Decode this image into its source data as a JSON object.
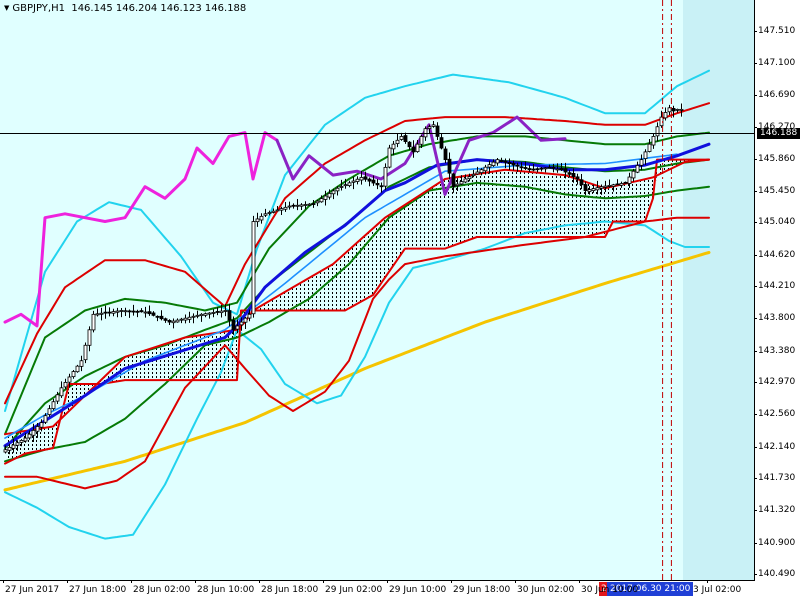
{
  "header": {
    "symbol": "GBPJPY,H1",
    "ohlc": "146.145 146.204 146.123 146.188"
  },
  "colors": {
    "background": "#e0ffff",
    "future_area": "#c9f1f6",
    "bullish_body": "#ffffff",
    "bearish_body": "#000000",
    "bid_line": "#000000",
    "ichimoku_cloud_hatch": "#000000",
    "ma_slow": "#f5c400",
    "vline_current": "#c00000",
    "time_tag_bg": "#1f3fd6",
    "time_tag_num_bg": "#e4161b"
  },
  "chart_data": {
    "type": "candlestick",
    "symbol": "GBPJPY",
    "timeframe": "H1",
    "ylim": [
      140.48,
      147.72
    ],
    "current_price": 146.188,
    "price_axis_ticks": [
      "147.510",
      "147.100",
      "146.690",
      "146.270",
      "145.860",
      "145.450",
      "145.040",
      "144.620",
      "144.210",
      "143.800",
      "143.380",
      "142.970",
      "142.560",
      "142.140",
      "141.730",
      "141.320",
      "140.900",
      "140.490"
    ],
    "time_axis_labels": [
      "27 Jun 2017",
      "27 Jun 18:00",
      "28 Jun 02:00",
      "28 Jun 10:00",
      "28 Jun 18:00",
      "29 Jun 02:00",
      "29 Jun 10:00",
      "29 Jun 18:00",
      "30 Jun 02:00",
      "30 Jun 10:00",
      "2017.06.30 21:00",
      "3 Jul 02:00"
    ],
    "time_tag_number": "2",
    "time_tag_selected": "2017.06.30 21:00",
    "price_anchors": [
      [
        0,
        142.07
      ],
      [
        6,
        142.25
      ],
      [
        10,
        142.45
      ],
      [
        15,
        142.9
      ],
      [
        20,
        143.25
      ],
      [
        23,
        143.85
      ],
      [
        30,
        143.9
      ],
      [
        36,
        143.88
      ],
      [
        42,
        143.75
      ],
      [
        50,
        143.85
      ],
      [
        56,
        143.9
      ],
      [
        58,
        143.65
      ],
      [
        62,
        143.85
      ],
      [
        63,
        145.05
      ],
      [
        66,
        145.15
      ],
      [
        72,
        145.25
      ],
      [
        78,
        145.28
      ],
      [
        84,
        145.48
      ],
      [
        90,
        145.62
      ],
      [
        95,
        145.5
      ],
      [
        97,
        146.0
      ],
      [
        100,
        146.15
      ],
      [
        103,
        145.95
      ],
      [
        106,
        146.25
      ],
      [
        108,
        146.3
      ],
      [
        111,
        145.85
      ],
      [
        113,
        145.5
      ],
      [
        116,
        145.6
      ],
      [
        120,
        145.72
      ],
      [
        124,
        145.85
      ],
      [
        128,
        145.78
      ],
      [
        132,
        145.72
      ],
      [
        137,
        145.75
      ],
      [
        140,
        145.72
      ],
      [
        144,
        145.6
      ],
      [
        146,
        145.45
      ],
      [
        150,
        145.5
      ],
      [
        156,
        145.55
      ],
      [
        160,
        145.85
      ],
      [
        163,
        146.15
      ],
      [
        165,
        146.4
      ],
      [
        167,
        146.52
      ],
      [
        168,
        146.48
      ],
      [
        169,
        146.5
      ]
    ],
    "future_from_bar": 169.5,
    "vlines_at_bars": [
      164.4,
      166.6
    ],
    "indicators": {
      "ma_slow_yellow": [
        [
          0,
          141.58
        ],
        [
          30,
          141.95
        ],
        [
          60,
          142.45
        ],
        [
          90,
          143.15
        ],
        [
          120,
          143.75
        ],
        [
          150,
          144.25
        ],
        [
          176,
          144.65
        ]
      ],
      "ma_blue_thick": [
        [
          0,
          142.15
        ],
        [
          20,
          142.8
        ],
        [
          30,
          143.15
        ],
        [
          55,
          143.55
        ],
        [
          58,
          143.7
        ],
        [
          65,
          144.2
        ],
        [
          75,
          144.65
        ],
        [
          85,
          145.0
        ],
        [
          95,
          145.45
        ],
        [
          100,
          145.55
        ],
        [
          108,
          145.78
        ],
        [
          118,
          145.85
        ],
        [
          130,
          145.8
        ],
        [
          140,
          145.72
        ],
        [
          150,
          145.72
        ],
        [
          160,
          145.78
        ],
        [
          168,
          145.9
        ],
        [
          176,
          146.05
        ]
      ],
      "ma_dodger": [
        [
          0,
          142.25
        ],
        [
          10,
          142.55
        ],
        [
          20,
          142.8
        ],
        [
          35,
          143.25
        ],
        [
          55,
          143.65
        ],
        [
          70,
          144.25
        ],
        [
          90,
          145.1
        ],
        [
          110,
          145.7
        ],
        [
          130,
          145.78
        ],
        [
          150,
          145.8
        ],
        [
          168,
          145.92
        ]
      ],
      "ichimoku_span_a_red": [
        [
          0,
          142.3
        ],
        [
          12,
          142.4
        ],
        [
          22,
          142.9
        ],
        [
          30,
          143.3
        ],
        [
          45,
          143.55
        ],
        [
          58,
          143.65
        ],
        [
          60,
          143.75
        ],
        [
          62,
          143.9
        ],
        [
          72,
          144.2
        ],
        [
          82,
          144.5
        ],
        [
          95,
          145.1
        ],
        [
          110,
          145.6
        ],
        [
          125,
          145.72
        ],
        [
          140,
          145.65
        ],
        [
          150,
          145.48
        ],
        [
          162,
          145.62
        ],
        [
          170,
          145.82
        ],
        [
          176,
          145.85
        ]
      ],
      "ichimoku_span_b_red": [
        [
          0,
          141.92
        ],
        [
          5,
          142.05
        ],
        [
          12,
          142.12
        ],
        [
          16,
          142.95
        ],
        [
          24,
          142.95
        ],
        [
          30,
          143.0
        ],
        [
          45,
          143.0
        ],
        [
          58,
          143.0
        ],
        [
          59,
          143.9
        ],
        [
          85,
          143.9
        ],
        [
          92,
          144.1
        ],
        [
          100,
          144.7
        ],
        [
          110,
          144.7
        ],
        [
          118,
          144.85
        ],
        [
          130,
          144.85
        ],
        [
          150,
          144.85
        ],
        [
          152,
          145.05
        ],
        [
          160,
          145.05
        ],
        [
          162,
          145.35
        ],
        [
          163,
          145.85
        ],
        [
          176,
          145.85
        ]
      ],
      "bollinger_red": {
        "upper": [
          [
            0,
            142.7
          ],
          [
            8,
            143.6
          ],
          [
            15,
            144.2
          ],
          [
            25,
            144.55
          ],
          [
            35,
            144.55
          ],
          [
            45,
            144.4
          ],
          [
            55,
            143.95
          ],
          [
            60,
            144.5
          ],
          [
            70,
            145.35
          ],
          [
            80,
            145.8
          ],
          [
            90,
            146.1
          ],
          [
            100,
            146.35
          ],
          [
            110,
            146.4
          ],
          [
            125,
            146.4
          ],
          [
            140,
            146.35
          ],
          [
            150,
            146.3
          ],
          [
            160,
            146.3
          ],
          [
            168,
            146.45
          ],
          [
            176,
            146.58
          ]
        ],
        "lower": [
          [
            0,
            141.75
          ],
          [
            8,
            141.75
          ],
          [
            20,
            141.6
          ],
          [
            28,
            141.7
          ],
          [
            35,
            141.95
          ],
          [
            45,
            142.9
          ],
          [
            55,
            143.45
          ],
          [
            60,
            143.15
          ],
          [
            66,
            142.8
          ],
          [
            72,
            142.6
          ],
          [
            80,
            142.85
          ],
          [
            86,
            143.25
          ],
          [
            92,
            144.05
          ],
          [
            96,
            144.3
          ],
          [
            100,
            144.5
          ],
          [
            110,
            144.6
          ],
          [
            130,
            144.75
          ],
          [
            145,
            144.85
          ],
          [
            160,
            145.05
          ],
          [
            168,
            145.1
          ],
          [
            176,
            145.1
          ]
        ],
        "mid": [
          [
            0,
            142.05
          ],
          [
            10,
            142.2
          ],
          [
            20,
            142.8
          ],
          [
            30,
            143.45
          ],
          [
            40,
            143.9
          ],
          [
            50,
            143.65
          ],
          [
            58,
            143.6
          ],
          [
            66,
            144.3
          ],
          [
            76,
            144.9
          ],
          [
            90,
            145.45
          ],
          [
            100,
            145.6
          ],
          [
            108,
            145.9
          ],
          [
            118,
            146.0
          ],
          [
            130,
            145.95
          ],
          [
            140,
            145.85
          ],
          [
            150,
            145.75
          ],
          [
            160,
            145.85
          ],
          [
            168,
            146.05
          ],
          [
            176,
            146.2
          ]
        ]
      },
      "bollinger_green": {
        "upper": [
          [
            0,
            142.3
          ],
          [
            10,
            143.55
          ],
          [
            20,
            143.9
          ],
          [
            30,
            144.05
          ],
          [
            40,
            144.0
          ],
          [
            50,
            143.9
          ],
          [
            58,
            144.0
          ],
          [
            66,
            144.7
          ],
          [
            76,
            145.25
          ],
          [
            86,
            145.6
          ],
          [
            96,
            145.9
          ],
          [
            106,
            146.05
          ],
          [
            118,
            146.15
          ],
          [
            130,
            146.15
          ],
          [
            140,
            146.1
          ],
          [
            150,
            146.05
          ],
          [
            160,
            146.05
          ],
          [
            168,
            146.15
          ],
          [
            176,
            146.2
          ]
        ],
        "lower": [
          [
            0,
            141.95
          ],
          [
            10,
            142.1
          ],
          [
            20,
            142.2
          ],
          [
            30,
            142.5
          ],
          [
            40,
            142.95
          ],
          [
            50,
            143.45
          ],
          [
            58,
            143.55
          ],
          [
            66,
            143.75
          ],
          [
            76,
            144.05
          ],
          [
            86,
            144.5
          ],
          [
            96,
            145.1
          ],
          [
            106,
            145.45
          ],
          [
            118,
            145.55
          ],
          [
            130,
            145.5
          ],
          [
            140,
            145.4
          ],
          [
            150,
            145.35
          ],
          [
            160,
            145.38
          ],
          [
            168,
            145.45
          ],
          [
            176,
            145.5
          ]
        ],
        "mid": [
          [
            0,
            142.12
          ],
          [
            10,
            142.7
          ],
          [
            20,
            143.05
          ],
          [
            30,
            143.3
          ],
          [
            40,
            143.45
          ],
          [
            50,
            143.65
          ],
          [
            58,
            143.8
          ],
          [
            66,
            144.25
          ],
          [
            76,
            144.65
          ],
          [
            86,
            145.05
          ],
          [
            96,
            145.5
          ],
          [
            106,
            145.75
          ],
          [
            118,
            145.85
          ],
          [
            130,
            145.82
          ],
          [
            140,
            145.75
          ],
          [
            150,
            145.7
          ],
          [
            160,
            145.72
          ],
          [
            168,
            145.8
          ],
          [
            176,
            145.85
          ]
        ]
      },
      "bollinger_cyan": {
        "upper": [
          [
            0,
            142.6
          ],
          [
            10,
            144.4
          ],
          [
            18,
            145.05
          ],
          [
            26,
            145.3
          ],
          [
            34,
            145.2
          ],
          [
            44,
            144.6
          ],
          [
            52,
            144.0
          ],
          [
            58,
            143.85
          ],
          [
            63,
            144.7
          ],
          [
            70,
            145.65
          ],
          [
            80,
            146.3
          ],
          [
            90,
            146.65
          ],
          [
            100,
            146.8
          ],
          [
            112,
            146.95
          ],
          [
            126,
            146.85
          ],
          [
            140,
            146.65
          ],
          [
            150,
            146.45
          ],
          [
            160,
            146.45
          ],
          [
            168,
            146.8
          ],
          [
            176,
            147.0
          ]
        ],
        "lower": [
          [
            0,
            141.55
          ],
          [
            8,
            141.35
          ],
          [
            16,
            141.1
          ],
          [
            25,
            140.95
          ],
          [
            32,
            141.0
          ],
          [
            40,
            141.65
          ],
          [
            48,
            142.5
          ],
          [
            54,
            143.1
          ],
          [
            58,
            143.65
          ],
          [
            64,
            143.4
          ],
          [
            70,
            142.95
          ],
          [
            78,
            142.7
          ],
          [
            84,
            142.8
          ],
          [
            90,
            143.3
          ],
          [
            96,
            144.0
          ],
          [
            102,
            144.45
          ],
          [
            110,
            144.55
          ],
          [
            120,
            144.7
          ],
          [
            130,
            144.9
          ],
          [
            140,
            145.0
          ],
          [
            150,
            145.05
          ],
          [
            160,
            145.0
          ],
          [
            166,
            144.8
          ],
          [
            170,
            144.72
          ],
          [
            176,
            144.72
          ]
        ]
      },
      "chikou_magenta": [
        [
          0,
          143.75
        ],
        [
          4,
          143.85
        ],
        [
          8,
          143.7
        ],
        [
          10,
          145.1
        ],
        [
          15,
          145.15
        ],
        [
          20,
          145.1
        ],
        [
          25,
          145.05
        ],
        [
          30,
          145.1
        ],
        [
          35,
          145.5
        ],
        [
          40,
          145.35
        ],
        [
          45,
          145.6
        ],
        [
          48,
          146.0
        ],
        [
          52,
          145.8
        ],
        [
          56,
          146.15
        ],
        [
          60,
          146.2
        ],
        [
          62,
          145.6
        ],
        [
          65,
          146.2
        ],
        [
          68,
          146.1
        ]
      ],
      "chikou_violet": [
        [
          68,
          146.1
        ],
        [
          72,
          145.6
        ],
        [
          76,
          145.9
        ],
        [
          82,
          145.65
        ],
        [
          88,
          145.7
        ],
        [
          94,
          145.6
        ],
        [
          100,
          145.8
        ],
        [
          106,
          146.3
        ],
        [
          110,
          145.4
        ],
        [
          116,
          146.1
        ],
        [
          122,
          146.2
        ],
        [
          128,
          146.4
        ],
        [
          134,
          146.1
        ],
        [
          140,
          146.12
        ]
      ]
    }
  }
}
